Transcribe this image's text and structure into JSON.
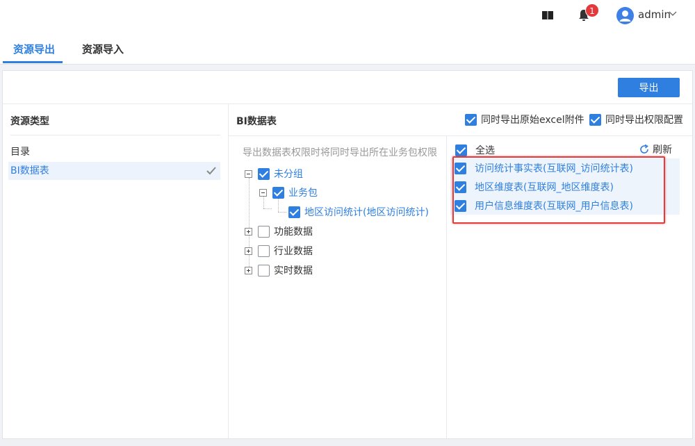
{
  "header": {
    "badge_count": "1",
    "username": "admin",
    "icons": [
      "book-icon",
      "bell-icon",
      "user-avatar-icon",
      "chevron-down-icon"
    ]
  },
  "tabs": [
    {
      "label": "资源导出",
      "active": true
    },
    {
      "label": "资源导入",
      "active": false
    }
  ],
  "toolbar": {
    "export_label": "导出"
  },
  "left_panel": {
    "title": "资源类型",
    "items": [
      {
        "label": "目录",
        "selected": false
      },
      {
        "label": "BI数据表",
        "selected": true
      }
    ]
  },
  "middle_panel": {
    "title": "BI数据表",
    "option_excel": "同时导出原始excel附件",
    "option_perm": "同时导出权限配置",
    "hint": "导出数据表权限时将同时导出所在业务包权限",
    "tree": {
      "group": "未分组",
      "package": "业务包",
      "table": "地区访问统计(地区访问统计)",
      "func": "功能数据",
      "industry": "行业数据",
      "realtime": "实时数据"
    }
  },
  "right_panel": {
    "select_all": "全选",
    "refresh": "刷新",
    "tables": [
      "访问统计事实表(互联网_访问统计表)",
      "地区维度表(互联网_地区维度表)",
      "用户信息维度表(互联网_用户信息表)"
    ]
  },
  "colors": {
    "accent": "#2f7fe0",
    "badge": "#e5383b",
    "highlight_border": "#e23b3b"
  }
}
